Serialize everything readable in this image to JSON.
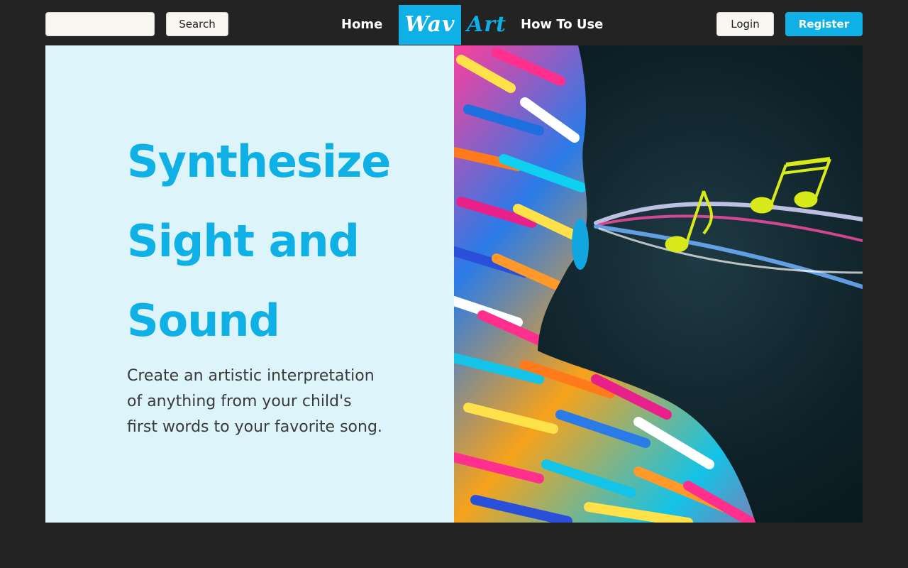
{
  "header": {
    "search": {
      "value": "",
      "placeholder": "",
      "button_label": "Search"
    },
    "nav": {
      "home_label": "Home",
      "how_to_use_label": "How To Use"
    },
    "logo": {
      "part1": "Wav",
      "part2": "Art"
    },
    "auth": {
      "login_label": "Login",
      "register_label": "Register"
    }
  },
  "hero": {
    "title_lines": [
      "Synthesize",
      "Sight and",
      "Sound"
    ],
    "subtitle_lines": [
      "Create an artistic interpretation",
      "of anything from your child's",
      "first words to your favorite song."
    ],
    "image_icon": "painted-face-with-music-notes"
  },
  "colors": {
    "accent": "#0fb0e6",
    "page_background": "#232323",
    "hero_panel": "#dcf4fa",
    "heading_text": "#0fb0e6",
    "body_text": "#3a3a3a",
    "note_yellow": "#d8ea1a"
  }
}
